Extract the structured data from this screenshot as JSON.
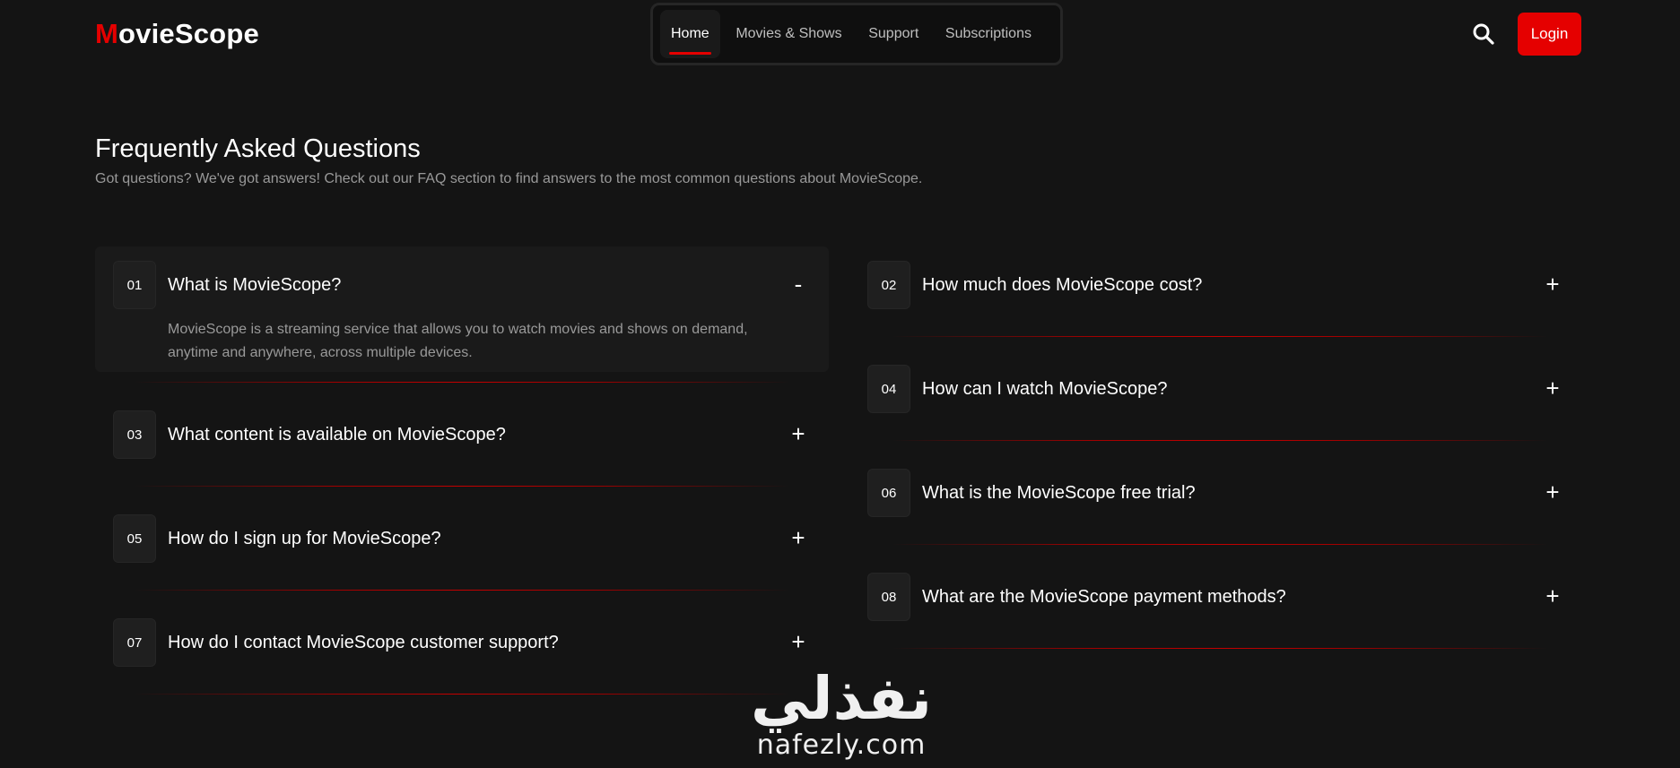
{
  "brand": {
    "first_letter": "M",
    "rest": "ovieScope"
  },
  "nav": {
    "items": [
      {
        "label": "Home",
        "active": true
      },
      {
        "label": "Movies & Shows"
      },
      {
        "label": "Support"
      },
      {
        "label": "Subscriptions"
      }
    ]
  },
  "header": {
    "search_icon": "search-icon",
    "login_label": "Login"
  },
  "faq": {
    "title": "Frequently Asked Questions",
    "subtitle": "Got questions? We've got answers! Check out our FAQ section to find answers to the most common questions about MovieScope.",
    "items": [
      {
        "num": "01",
        "question": "What is MovieScope?",
        "toggle": "-",
        "answer": "MovieScope is a streaming service that allows you to watch movies and shows on demand, anytime and anywhere, across multiple devices."
      },
      {
        "num": "02",
        "question": "How much does MovieScope cost?",
        "toggle": "+"
      },
      {
        "num": "03",
        "question": "What content is available on MovieScope?",
        "toggle": "+"
      },
      {
        "num": "04",
        "question": "How can I watch MovieScope?",
        "toggle": "+"
      },
      {
        "num": "05",
        "question": "How do I sign up for MovieScope?",
        "toggle": "+"
      },
      {
        "num": "06",
        "question": "What is the MovieScope free trial?",
        "toggle": "+"
      },
      {
        "num": "07",
        "question": "How do I contact MovieScope customer support?",
        "toggle": "+"
      },
      {
        "num": "08",
        "question": "What are the MovieScope payment methods?",
        "toggle": "+"
      }
    ]
  },
  "watermark": {
    "arabic": "نفذلي",
    "latin": "nafezly.com"
  },
  "colors": {
    "accent": "#e50000",
    "background": "#141414",
    "muted_text": "#999999"
  }
}
